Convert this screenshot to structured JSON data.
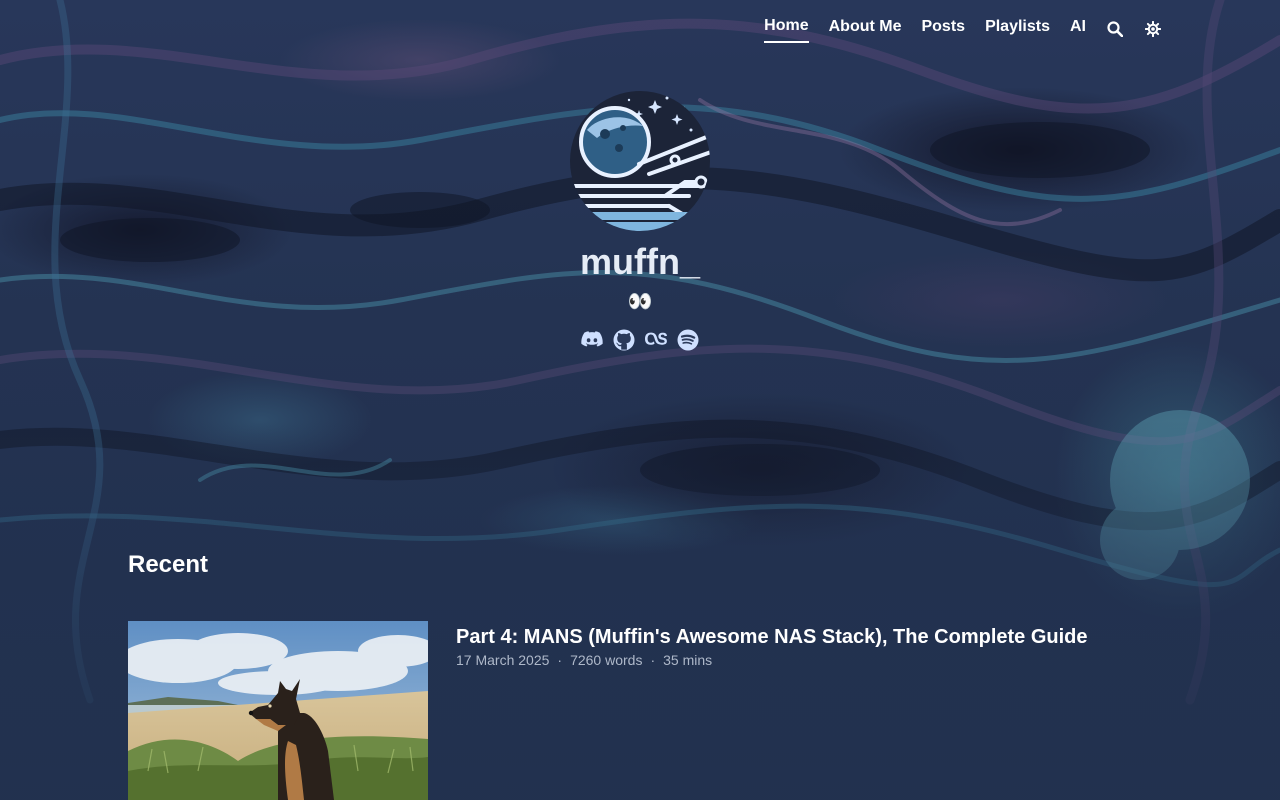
{
  "nav": {
    "items": [
      {
        "label": "Home",
        "active": true
      },
      {
        "label": "About Me",
        "active": false
      },
      {
        "label": "Posts",
        "active": false
      },
      {
        "label": "Playlists",
        "active": false
      },
      {
        "label": "AI",
        "active": false
      }
    ],
    "icons": [
      "search-icon",
      "theme-toggle-icon"
    ]
  },
  "profile": {
    "name": "muffn_",
    "subtitle": "👀",
    "avatar_icon": "planet-circuit-logo",
    "socials": [
      {
        "icon": "discord-icon"
      },
      {
        "icon": "github-icon"
      },
      {
        "icon": "lastfm-icon"
      },
      {
        "icon": "spotify-icon"
      }
    ]
  },
  "recent": {
    "heading": "Recent",
    "posts": [
      {
        "title": "Part 4: MANS (Muffin's Awesome NAS Stack), The Complete Guide",
        "date": "17 March 2025",
        "words": "7260 words",
        "read_time": "35 mins",
        "separator": "·"
      }
    ]
  },
  "colors": {
    "background": "#223150",
    "text": "#ffffff",
    "meta_text": "#aeb8c9",
    "icon_tint": "#cfe0ff"
  }
}
